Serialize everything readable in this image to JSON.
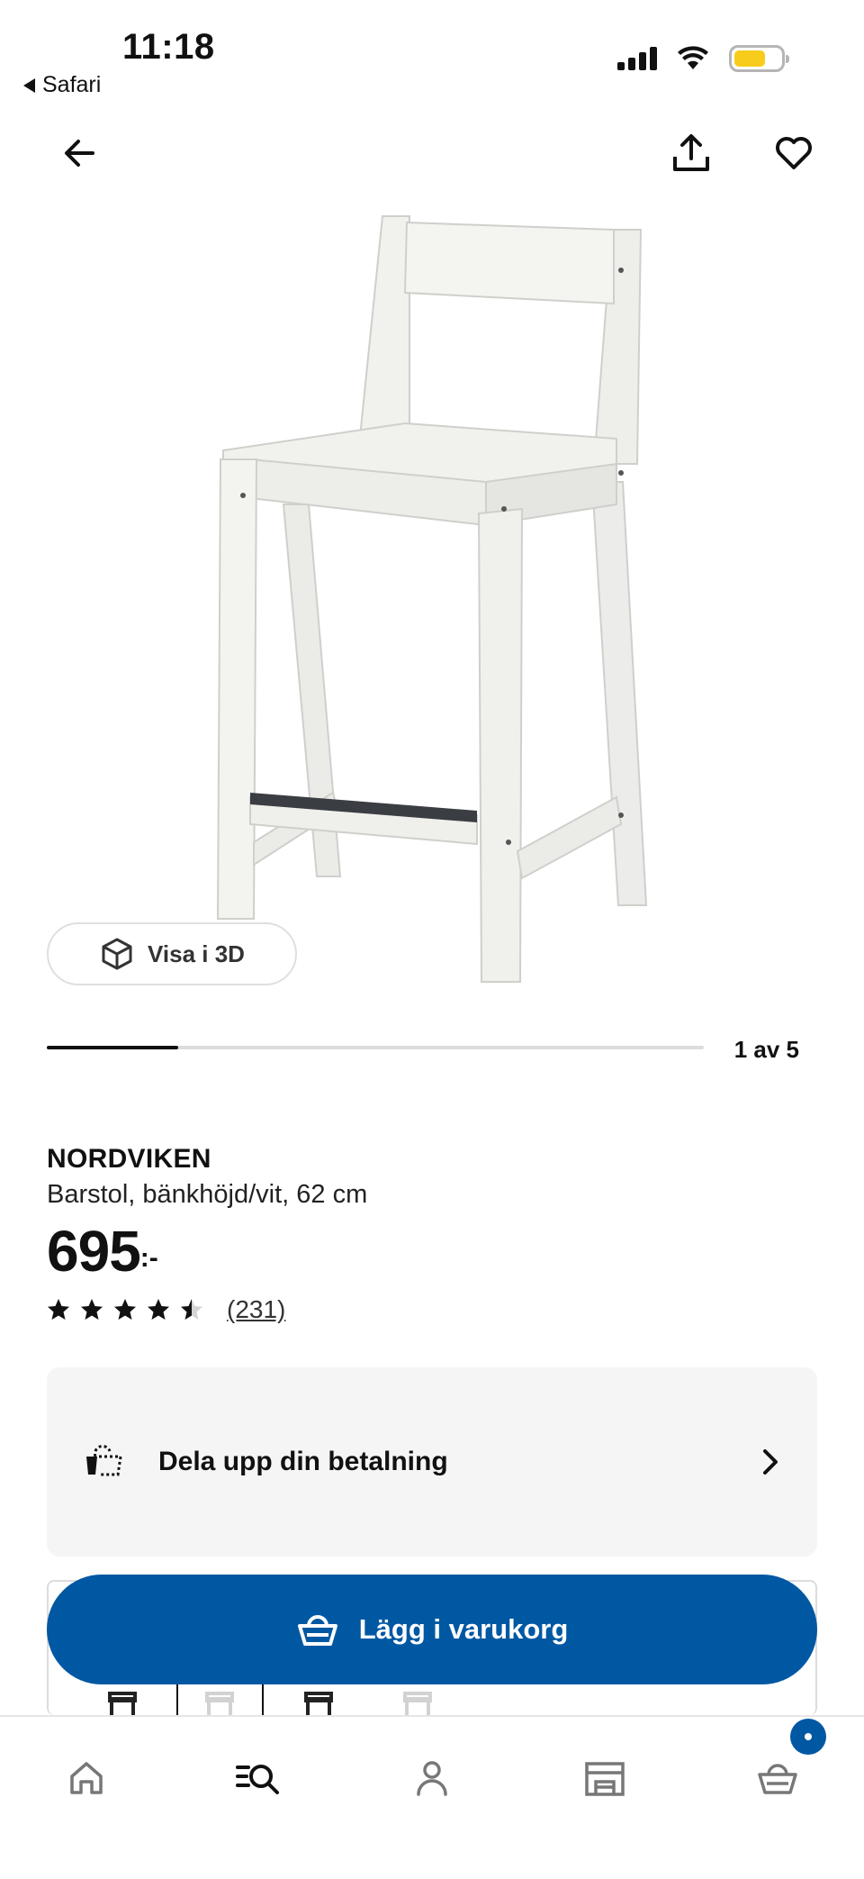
{
  "status_bar": {
    "time": "11:18",
    "back_label": "Safari"
  },
  "carousel": {
    "view3d_label": "Visa i 3D",
    "page_indicator": "1 av 5",
    "current": 1,
    "total": 5,
    "progress_fraction": 0.2
  },
  "product": {
    "name": "NORDVIKEN",
    "description": "Barstol, bänkhöjd/vit, 62 cm",
    "price": "695",
    "price_suffix": ":-",
    "rating": 4.5,
    "review_count": "(231)"
  },
  "payment": {
    "label": "Dela upp din betalning"
  },
  "cart_button": {
    "label": "Lägg i varukorg"
  },
  "tabs": [
    {
      "name": "home",
      "icon": "home-icon"
    },
    {
      "name": "search",
      "icon": "search-list-icon"
    },
    {
      "name": "profile",
      "icon": "person-icon"
    },
    {
      "name": "stores",
      "icon": "store-icon"
    },
    {
      "name": "cart",
      "icon": "basket-icon"
    }
  ],
  "colors": {
    "primary": "#0058a3",
    "card_bg": "#f5f5f5",
    "battery": "#f7cc1b"
  }
}
